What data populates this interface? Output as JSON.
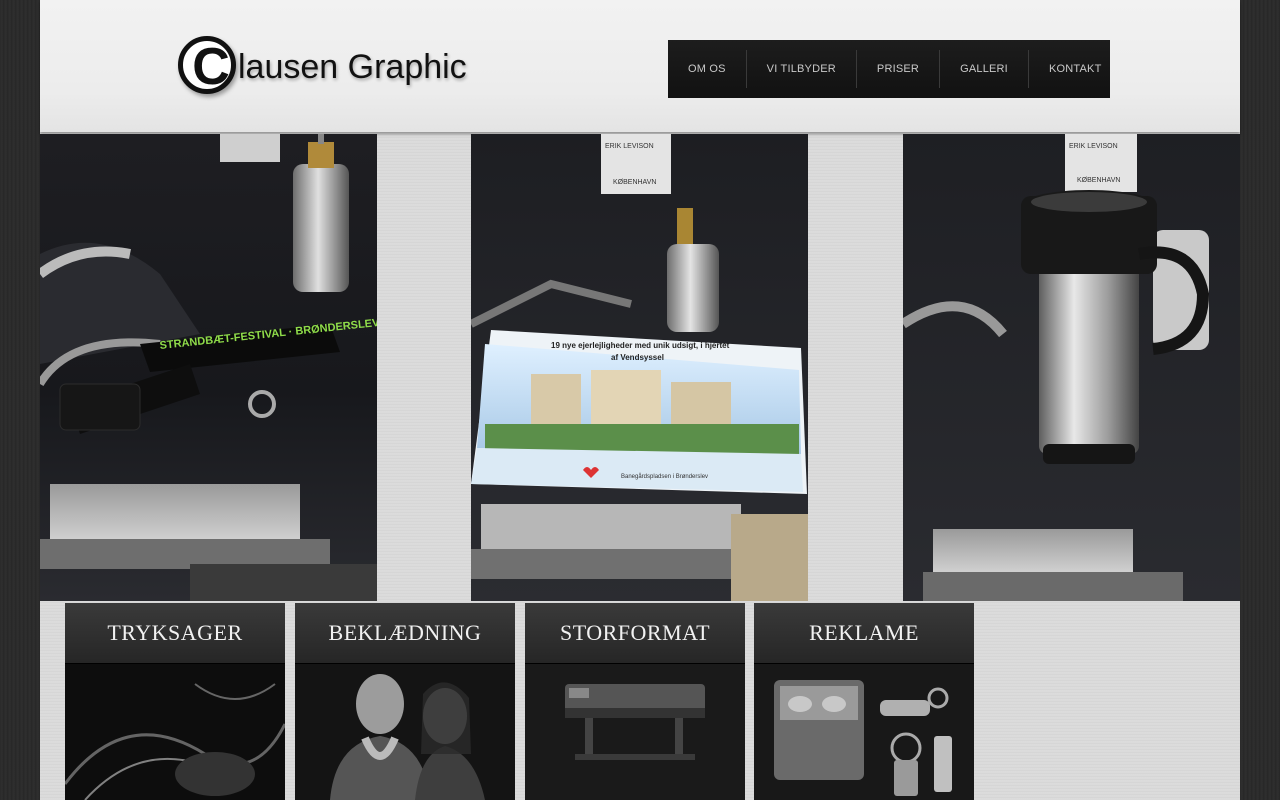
{
  "brand": {
    "logo_letter": "C",
    "logo_rest": "lausen Graphic"
  },
  "nav": {
    "items": [
      "OM OS",
      "VI TILBYDER",
      "PRISER",
      "GALLERI",
      "KONTAKT"
    ]
  },
  "gallery": {
    "photo1": {
      "lanyard_text": "STRANDBÆT-FESTIVAL · BRØNDERSLEV"
    },
    "photo2": {
      "flyer_title": "19 nye ejerlejligheder med unik udsigt, i hjertet",
      "flyer_title2": "af Vendsyssel",
      "flyer_footer": "Banegårdspladsen i Brønderslev",
      "sign_line1": "ERIK LEVISON",
      "sign_line2": "KØBENHAVN"
    },
    "photo3": {
      "sign_line1": "ERIK LEVISON",
      "sign_line2": "KØBENHAVN"
    }
  },
  "categories": [
    {
      "label": "TRYKSAGER"
    },
    {
      "label": "BEKLÆDNING"
    },
    {
      "label": "STORFORMAT"
    },
    {
      "label": "REKLAME"
    }
  ],
  "colors": {
    "nav_bg": "#151515",
    "nav_text": "#c9c9c9",
    "category_header": "#2e2e2e",
    "page_bg": "#d9d9d9"
  }
}
